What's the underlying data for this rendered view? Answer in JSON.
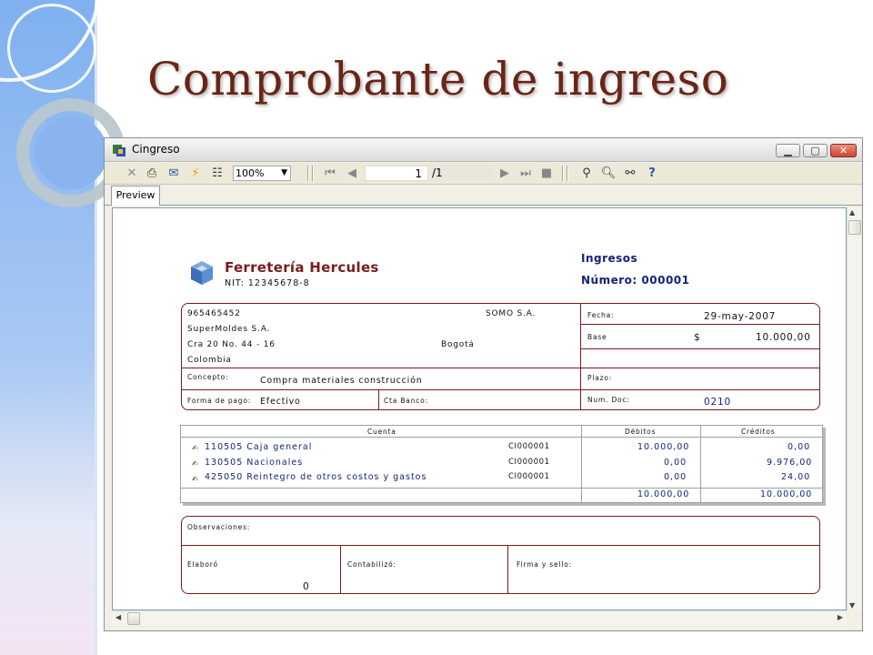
{
  "slide": {
    "title": "Comprobante de ingreso"
  },
  "window": {
    "title": "Cingreso",
    "zoom": "100%",
    "page_current": "1",
    "page_total": "/1",
    "tab_preview": "Preview"
  },
  "report": {
    "company": "Ferretería Hercules",
    "nit": "NIT: 12345678-8",
    "doc_type": "Ingresos",
    "numero_label": "Número:",
    "numero_value": "000001",
    "client_id": "965465452",
    "client_name": "SuperMoldes S.A.",
    "client_address": "Cra 20 No. 44 - 16",
    "client_country": "Colombia",
    "client_org": "SOMO S.A.",
    "client_city": "Bogotá",
    "fecha_label": "Fecha:",
    "fecha_value": "29-may-2007",
    "base_label": "Base",
    "base_currency": "$",
    "base_value": "10.000,00",
    "concepto_label": "Concepto:",
    "concepto_value": "Compra materiales construcción",
    "plazo_label": "Plazo:",
    "forma_pago_label": "Forma de pago:",
    "forma_pago_value": "Efectivo",
    "cta_banco_label": "Cta Banco:",
    "num_doc_label": "Num. Doc:",
    "num_doc_value": "0210",
    "grid": {
      "headers": {
        "cuenta": "Cuenta",
        "debitos": "Débitos",
        "creditos": "Créditos"
      },
      "rows": [
        {
          "cuenta": "110505",
          "nombre": "Caja general",
          "ref": "CI000001",
          "debito": "10.000,00",
          "credito": "0,00"
        },
        {
          "cuenta": "130505",
          "nombre": "Nacionales",
          "ref": "CI000001",
          "debito": "0,00",
          "credito": "9.976,00"
        },
        {
          "cuenta": "425050",
          "nombre": "Reintegro de otros costos y gastos",
          "ref": "CI000001",
          "debito": "0,00",
          "credito": "24,00"
        }
      ],
      "total_debito": "10.000,00",
      "total_credito": "10.000,00"
    },
    "observaciones_label": "Observaciones:",
    "elaboro_label": "Elaboró",
    "elaboro_value": "0",
    "contabilizo_label": "Contabilizó:",
    "firma_label": "Firma y sello:"
  }
}
